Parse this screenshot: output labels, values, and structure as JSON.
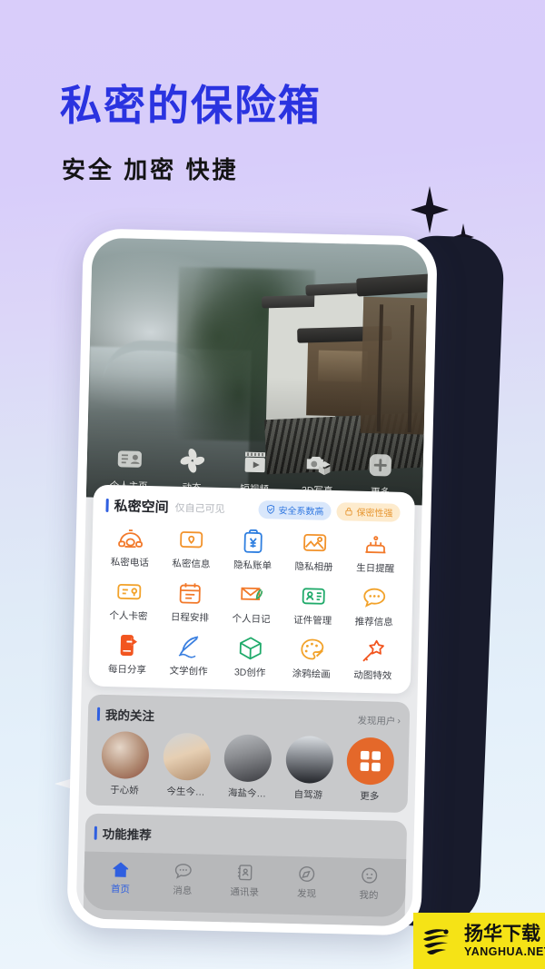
{
  "poster": {
    "headline": "私密的保险箱",
    "subhead": "安全  加密  快捷",
    "headline_color": "#2a33e0",
    "bg_top_color": "#d9cdfa",
    "bg_bottom_color": "#edf5fc"
  },
  "hero": {
    "icons": [
      {
        "label": "个人主页",
        "icon": "id-card-icon"
      },
      {
        "label": "动态",
        "icon": "pinwheel-icon"
      },
      {
        "label": "短视频",
        "icon": "film-play-icon"
      },
      {
        "label": "3D写真",
        "icon": "camera-cube-icon"
      },
      {
        "label": "更多",
        "icon": "plus-icon"
      }
    ]
  },
  "private_space": {
    "title": "私密空间",
    "subtitle": "仅自己可见",
    "badges": [
      {
        "label": "安全系数高",
        "icon": "shield-check-icon",
        "color": "#3178e0",
        "bg": "#d9e7fb"
      },
      {
        "label": "保密性强",
        "icon": "lock-icon",
        "color": "#e79733",
        "bg": "#fdebcd"
      }
    ],
    "items": [
      {
        "label": "私密电话",
        "icon": "telephone-icon",
        "color": "#f2792a"
      },
      {
        "label": "私密信息",
        "icon": "envelope-pin-icon",
        "color": "#f2922a"
      },
      {
        "label": "隐私账单",
        "icon": "clipboard-yen-icon",
        "color": "#2f7fe0"
      },
      {
        "label": "隐私相册",
        "icon": "photo-pin-icon",
        "color": "#f2922a"
      },
      {
        "label": "生日提醒",
        "icon": "birthday-cake-icon",
        "color": "#f2792a"
      },
      {
        "label": "个人卡密",
        "icon": "card-key-icon",
        "color": "#f2a22a"
      },
      {
        "label": "日程安排",
        "icon": "calendar-icon",
        "color": "#f2792a"
      },
      {
        "label": "个人日记",
        "icon": "envelope-pen-icon",
        "color": "#f2792a"
      },
      {
        "label": "证件管理",
        "icon": "id-badge-icon",
        "color": "#1faa6a"
      },
      {
        "label": "推荐信息",
        "icon": "chat-dots-icon",
        "color": "#f2a22a"
      },
      {
        "label": "每日分享",
        "icon": "phone-share-icon",
        "color": "#f2551f"
      },
      {
        "label": "文学创作",
        "icon": "quill-icon",
        "color": "#3a7fe0"
      },
      {
        "label": "3D创作",
        "icon": "cube-icon",
        "color": "#1faa6a"
      },
      {
        "label": "涂鸦绘画",
        "icon": "palette-icon",
        "color": "#f2a22a"
      },
      {
        "label": "动图特效",
        "icon": "magic-star-icon",
        "color": "#f2551f"
      }
    ]
  },
  "follow": {
    "title": "我的关注",
    "more_label": "发现用户",
    "users": [
      {
        "name": "于心娇"
      },
      {
        "name": "今生今…"
      },
      {
        "name": "海盐今…"
      },
      {
        "name": "自驾游"
      },
      {
        "name": "更多",
        "icon": "grid-more-icon"
      }
    ]
  },
  "func_rec": {
    "title": "功能推荐"
  },
  "tabbar": {
    "tabs": [
      {
        "label": "首页",
        "icon": "home-icon",
        "active": true
      },
      {
        "label": "消息",
        "icon": "message-icon",
        "active": false
      },
      {
        "label": "通讯录",
        "icon": "contacts-icon",
        "active": false
      },
      {
        "label": "发现",
        "icon": "compass-icon",
        "active": false
      },
      {
        "label": "我的",
        "icon": "profile-icon",
        "active": false
      }
    ]
  },
  "watermark": {
    "cn": "扬华下载",
    "en": "YANGHUA.NET",
    "bg": "#f5e316"
  }
}
